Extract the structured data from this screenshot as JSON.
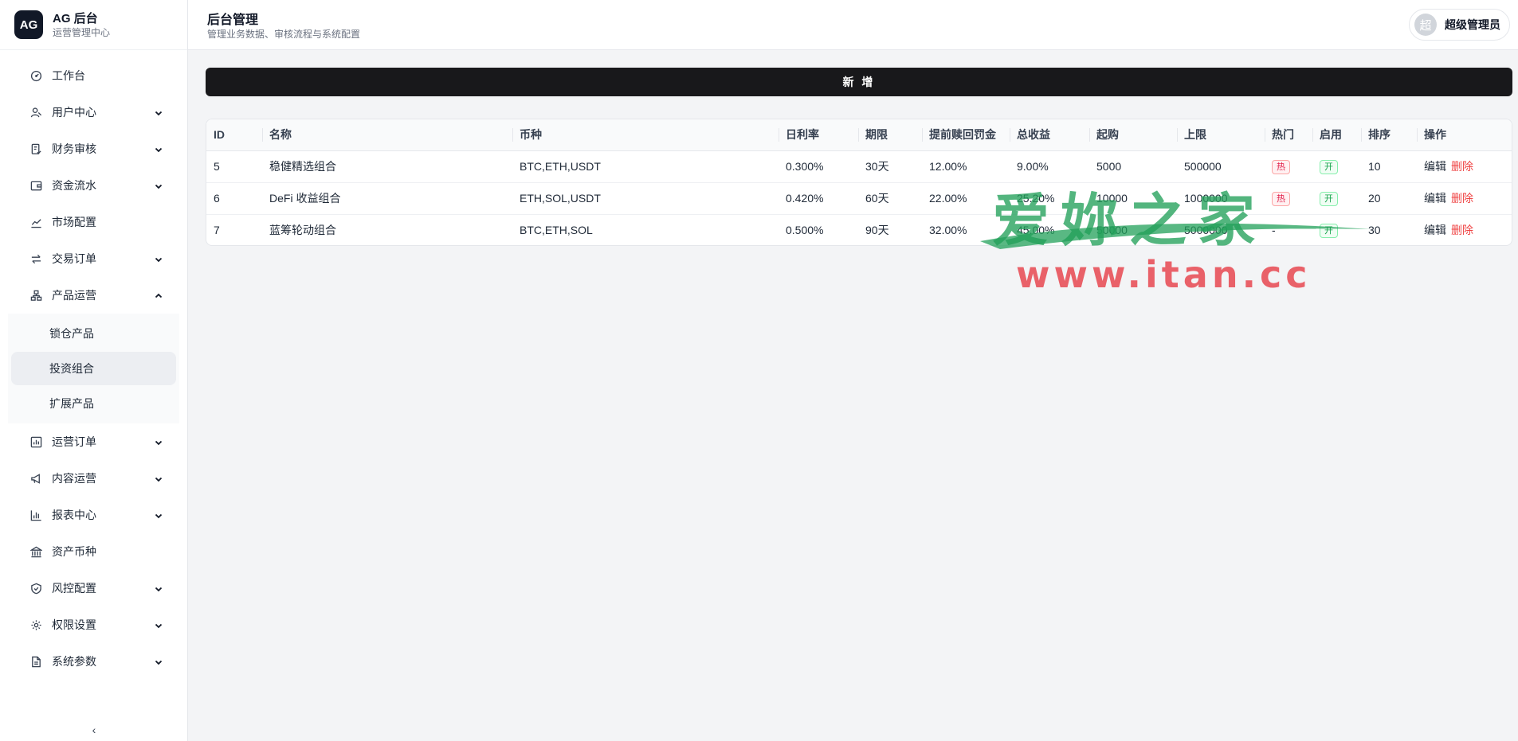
{
  "brand": {
    "logo": "AG",
    "title": "AG 后台",
    "subtitle": "运营管理中心"
  },
  "header": {
    "title": "后台管理",
    "subtitle": "管理业务数据、审核流程与系统配置",
    "user_avatar": "超",
    "user_name": "超级管理员"
  },
  "sidebar": {
    "items": [
      {
        "label": "工作台",
        "icon": "gauge-icon",
        "has_children": false
      },
      {
        "label": "用户中心",
        "icon": "user-icon",
        "has_children": true
      },
      {
        "label": "财务审核",
        "icon": "document-check-icon",
        "has_children": true
      },
      {
        "label": "资金流水",
        "icon": "wallet-icon",
        "has_children": true
      },
      {
        "label": "市场配置",
        "icon": "trend-icon",
        "has_children": false
      },
      {
        "label": "交易订单",
        "icon": "exchange-icon",
        "has_children": true
      },
      {
        "label": "产品运营",
        "icon": "boxes-icon",
        "has_children": true,
        "expanded": true,
        "children": [
          {
            "label": "锁仓产品"
          },
          {
            "label": "投资组合",
            "active": true
          },
          {
            "label": "扩展产品"
          }
        ]
      },
      {
        "label": "运营订单",
        "icon": "orders-icon",
        "has_children": true
      },
      {
        "label": "内容运营",
        "icon": "megaphone-icon",
        "has_children": true
      },
      {
        "label": "报表中心",
        "icon": "bar-chart-icon",
        "has_children": true
      },
      {
        "label": "资产币种",
        "icon": "bank-icon",
        "has_children": false
      },
      {
        "label": "风控配置",
        "icon": "shield-icon",
        "has_children": true
      },
      {
        "label": "权限设置",
        "icon": "gear-icon",
        "has_children": true
      },
      {
        "label": "系统参数",
        "icon": "file-icon",
        "has_children": true
      }
    ],
    "collapse_icon": "‹"
  },
  "toolbar": {
    "add_label": "新 增"
  },
  "table": {
    "columns": [
      "ID",
      "名称",
      "币种",
      "日利率",
      "期限",
      "提前赎回罚金",
      "总收益",
      "起购",
      "上限",
      "热门",
      "启用",
      "排序",
      "操作"
    ],
    "rows": [
      {
        "id": "5",
        "name": "稳健精选组合",
        "coins": "BTC,ETH,USDT",
        "daily_rate": "0.300%",
        "term": "30天",
        "penalty": "12.00%",
        "total_yield": "9.00%",
        "min": "5000",
        "max": "500000",
        "hot": "热",
        "enabled": "开",
        "sort": "10",
        "edit": "编辑",
        "delete": "删除"
      },
      {
        "id": "6",
        "name": "DeFi 收益组合",
        "coins": "ETH,SOL,USDT",
        "daily_rate": "0.420%",
        "term": "60天",
        "penalty": "22.00%",
        "total_yield": "25.20%",
        "min": "10000",
        "max": "1000000",
        "hot": "热",
        "enabled": "开",
        "sort": "20",
        "edit": "编辑",
        "delete": "删除"
      },
      {
        "id": "7",
        "name": "蓝筹轮动组合",
        "coins": "BTC,ETH,SOL",
        "daily_rate": "0.500%",
        "term": "90天",
        "penalty": "32.00%",
        "total_yield": "45.00%",
        "min": "50000",
        "max": "5000000",
        "hot": "-",
        "enabled": "开",
        "sort": "30",
        "edit": "编辑",
        "delete": "删除"
      }
    ]
  },
  "watermark": {
    "line1": "爱妳之家",
    "line2": "www.itan.cc"
  },
  "colors": {
    "primary_button": "#18181b",
    "danger": "#ef4444",
    "hot_tag": "#e11d48",
    "on_tag": "#16a34a",
    "watermark_green": "#22a05a",
    "watermark_red": "#e64650"
  }
}
